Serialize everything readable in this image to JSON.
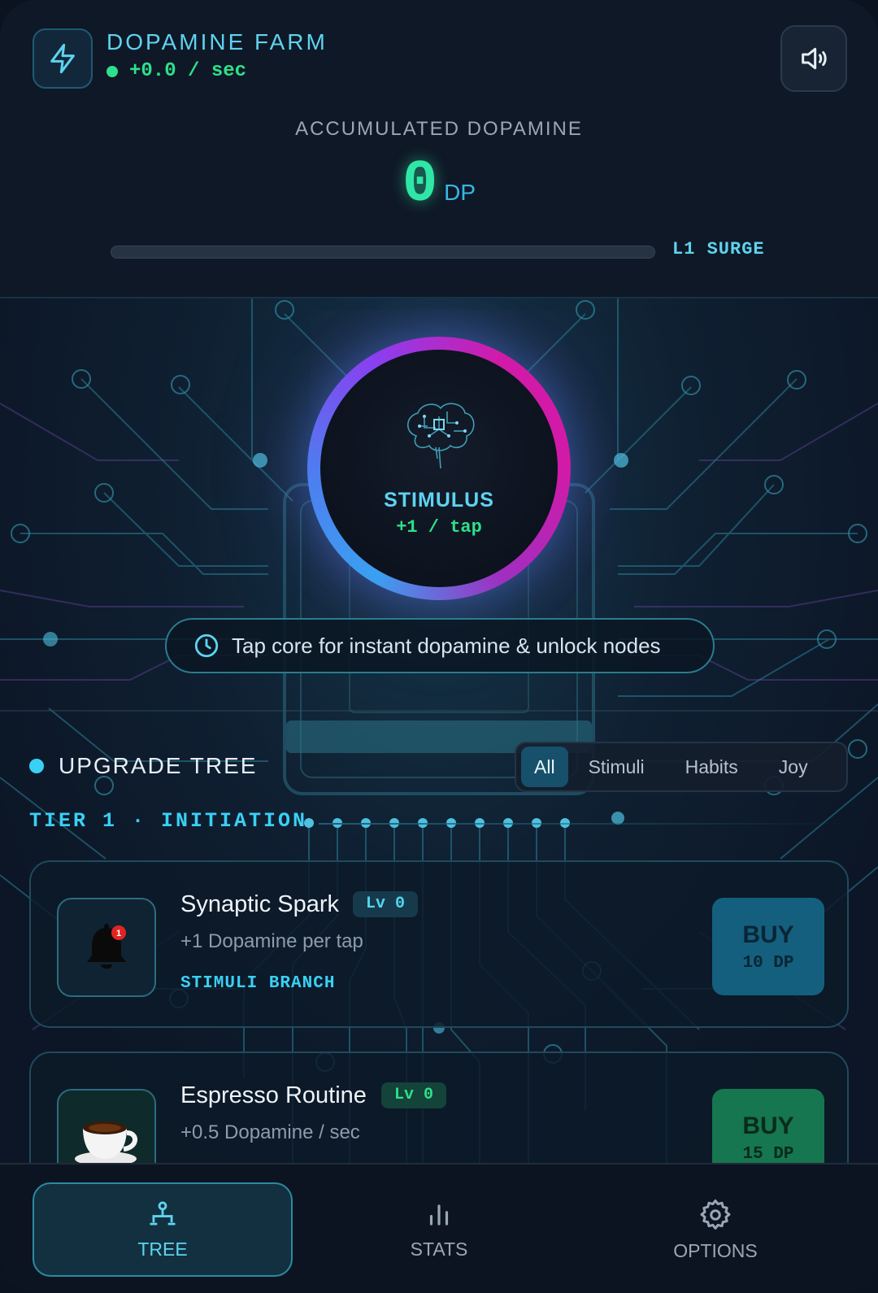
{
  "header": {
    "app_title": "DOPAMINE FARM",
    "rate": "+0.0 / sec",
    "accumulated_label": "ACCUMULATED DOPAMINE",
    "accumulated_value": "0",
    "accumulated_unit": "DP",
    "surge_progress": 0,
    "surge_label": "L1 SURGE",
    "icons": {
      "logo": "lightning-bolt-icon",
      "sound": "speaker-volume-icon"
    }
  },
  "core": {
    "title": "STIMULUS",
    "subtitle": "+1 / tap",
    "icon": "circuit-brain-icon"
  },
  "hint": {
    "text": "Tap core for instant dopamine & unlock nodes",
    "icon": "clock-icon"
  },
  "upgrades": {
    "title": "UPGRADE TREE",
    "tabs": [
      {
        "label": "All",
        "active": true
      },
      {
        "label": "Stimuli",
        "active": false
      },
      {
        "label": "Habits",
        "active": false
      },
      {
        "label": "Joy",
        "active": false
      }
    ],
    "tier_label": "TIER 1 · INITIATION",
    "cards": [
      {
        "name": "Synaptic Spark",
        "level": "Lv 0",
        "description": "+1 Dopamine per tap",
        "branch": "STIMULI BRANCH",
        "icon": "notification-bell-icon",
        "buy_label": "BUY",
        "cost": "10 DP"
      },
      {
        "name": "Espresso Routine",
        "level": "Lv 0",
        "description": "+0.5 Dopamine / sec",
        "icon": "espresso-cup-icon",
        "buy_label": "BUY",
        "cost": "15 DP"
      }
    ]
  },
  "nav": {
    "items": [
      {
        "label": "TREE",
        "icon": "tree-hierarchy-icon",
        "active": true
      },
      {
        "label": "STATS",
        "icon": "bar-chart-icon",
        "active": false
      },
      {
        "label": "OPTIONS",
        "icon": "gear-icon",
        "active": false
      }
    ]
  },
  "colors": {
    "accent_cyan": "#5ed3f0",
    "accent_green": "#2ee08a",
    "ring_start": "#3aa0f0",
    "ring_end": "#d21aa8",
    "background": "#0d1523"
  }
}
